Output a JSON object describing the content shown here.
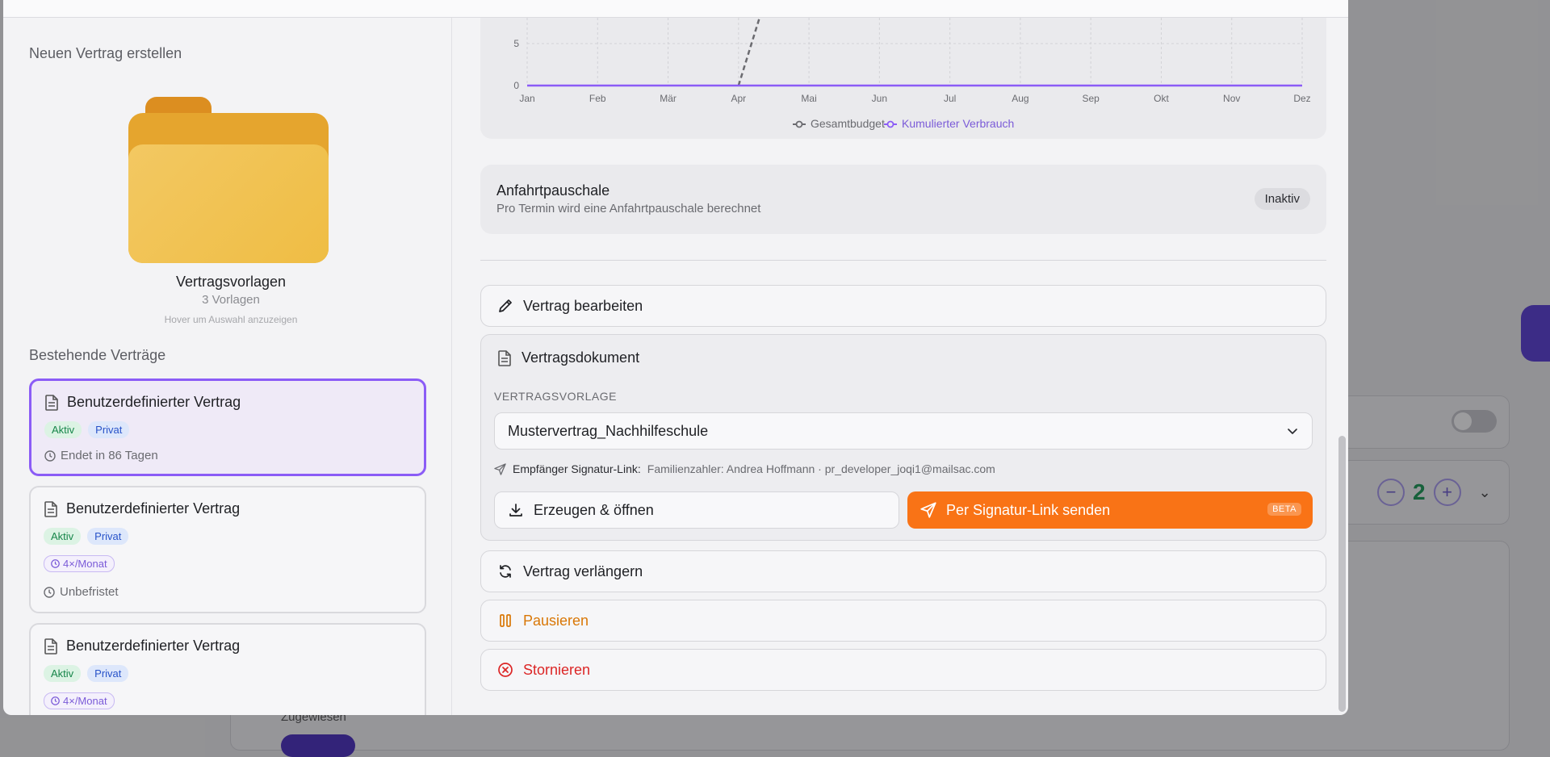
{
  "modal": {
    "left": {
      "new_contract_title": "Neuen Vertrag erstellen",
      "templates_title": "Vertragsvorlagen",
      "templates_count": "3 Vorlagen",
      "templates_hint": "Hover um Auswahl anzuzeigen",
      "existing_title": "Bestehende Verträge",
      "contracts": [
        {
          "title": "Benutzerdefinierter Vertrag",
          "status": "Aktiv",
          "type": "Privat",
          "frequency": "",
          "meta": "Endet in 86 Tagen",
          "selected": true
        },
        {
          "title": "Benutzerdefinierter Vertrag",
          "status": "Aktiv",
          "type": "Privat",
          "frequency": "4×/Monat",
          "meta": "Unbefristet",
          "selected": false
        },
        {
          "title": "Benutzerdefinierter Vertrag",
          "status": "Aktiv",
          "type": "Privat",
          "frequency": "4×/Monat",
          "meta": "",
          "selected": false
        }
      ]
    },
    "right": {
      "travel_fee": {
        "title": "Anfahrtpauschale",
        "subtitle": "Pro Termin wird eine Anfahrtpauschale berechnet",
        "status": "Inaktiv"
      },
      "edit_button": "Vertrag bearbeiten",
      "document": {
        "title": "Vertragsdokument",
        "template_label": "VERTRAGSVORLAGE",
        "selected_template": "Mustervertrag_Nachhilfeschule",
        "recipient_label": "Empfänger Signatur-Link:",
        "recipient_value": "Familienzahler: Andrea Hoffmann · pr_developer_joqi1@mailsac.com",
        "generate_button": "Erzeugen & öffnen",
        "send_button": "Per Signatur-Link senden",
        "send_badge": "BETA"
      },
      "renew_button": "Vertrag verlängern",
      "pause_button": "Pausieren",
      "cancel_button": "Stornieren"
    }
  },
  "background": {
    "quantity": "2",
    "assigned_label": "Zugewiesen"
  },
  "chart_data": {
    "type": "line",
    "categories": [
      "Jan",
      "Feb",
      "Mär",
      "Apr",
      "Mai",
      "Jun",
      "Jul",
      "Aug",
      "Sep",
      "Okt",
      "Nov",
      "Dez"
    ],
    "y_ticks": [
      0,
      5
    ],
    "series": [
      {
        "name": "Gesamtbudget",
        "style": "dashed",
        "color": "#6b6b70",
        "values": [
          null,
          null,
          null,
          0
        ]
      },
      {
        "name": "Kumulierter Verbrauch",
        "style": "solid",
        "color": "#8b5cf6",
        "values": [
          0,
          0,
          0,
          0,
          0,
          0,
          0,
          0,
          0,
          0,
          0,
          0
        ]
      }
    ],
    "legend": "bottom-center",
    "grid": true
  },
  "colors": {
    "accent": "#8b5cf6",
    "orange": "#f97316",
    "success": "#17864a",
    "warning": "#d97706",
    "danger": "#dc2626"
  }
}
